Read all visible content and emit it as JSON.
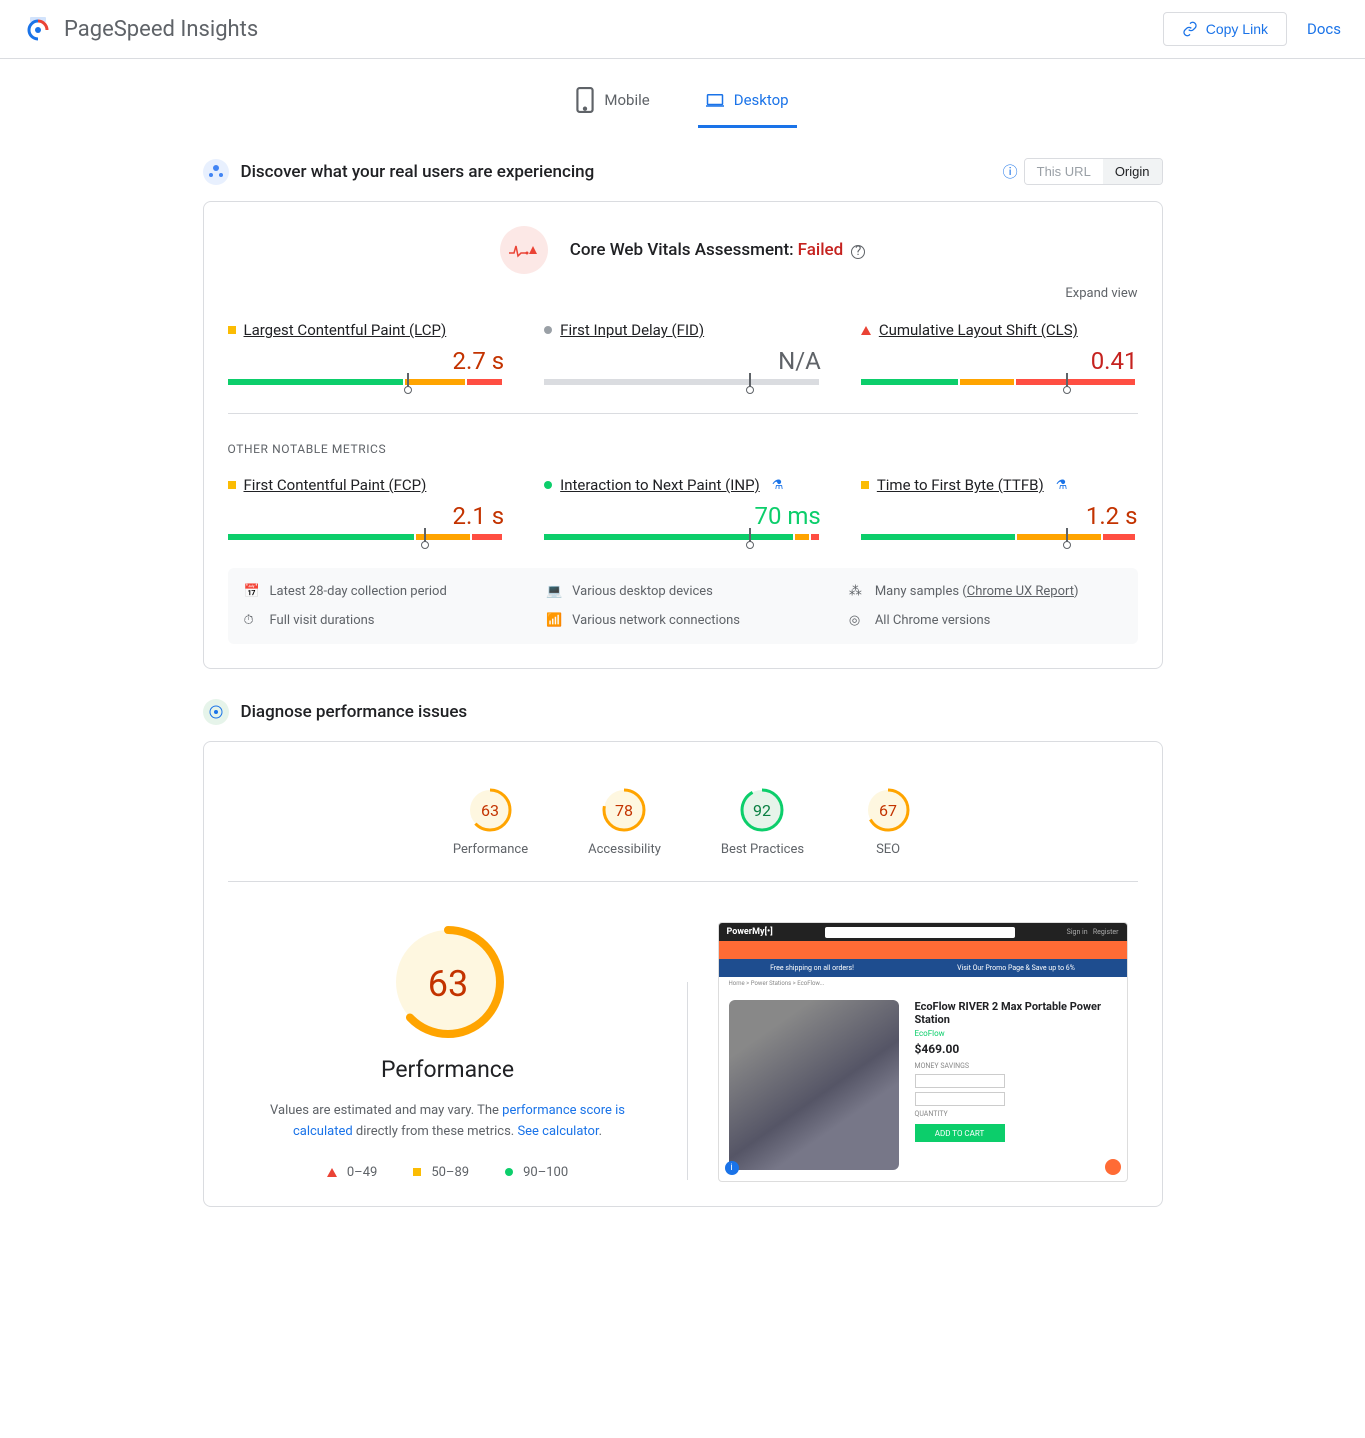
{
  "header": {
    "app_title": "PageSpeed Insights",
    "copy_link": "Copy Link",
    "docs": "Docs"
  },
  "tabs": {
    "mobile": "Mobile",
    "desktop": "Desktop"
  },
  "field": {
    "section_title": "Discover what your real users are experiencing",
    "toggle_url": "This URL",
    "toggle_origin": "Origin",
    "cwv_label": "Core Web Vitals Assessment:",
    "cwv_status": "Failed",
    "expand": "Expand view",
    "other_title": "OTHER NOTABLE METRICS",
    "metrics": {
      "lcp": {
        "name": "Largest Contentful Paint (LCP)",
        "value": "2.7 s"
      },
      "fid": {
        "name": "First Input Delay (FID)",
        "value": "N/A"
      },
      "cls": {
        "name": "Cumulative Layout Shift (CLS)",
        "value": "0.41"
      },
      "fcp": {
        "name": "First Contentful Paint (FCP)",
        "value": "2.1 s"
      },
      "inp": {
        "name": "Interaction to Next Paint (INP)",
        "value": "70 ms"
      },
      "ttfb": {
        "name": "Time to First Byte (TTFB)",
        "value": "1.2 s"
      }
    },
    "info": {
      "period": "Latest 28-day collection period",
      "devices": "Various desktop devices",
      "samples_pre": "Many samples (",
      "samples_link": "Chrome UX Report",
      "samples_post": ")",
      "durations": "Full visit durations",
      "network": "Various network connections",
      "chrome": "All Chrome versions"
    }
  },
  "lab": {
    "section_title": "Diagnose performance issues",
    "scores": {
      "performance": {
        "value": "63",
        "label": "Performance"
      },
      "accessibility": {
        "value": "78",
        "label": "Accessibility"
      },
      "best_practices": {
        "value": "92",
        "label": "Best Practices"
      },
      "seo": {
        "value": "67",
        "label": "SEO"
      }
    },
    "perf_big": "63",
    "perf_title": "Performance",
    "perf_desc_1": "Values are estimated and may vary. The ",
    "perf_link_1": "performance score is calculated",
    "perf_desc_2": " directly from these metrics. ",
    "perf_link_2": "See calculator",
    "perf_desc_3": ".",
    "legend": {
      "poor": "0–49",
      "avg": "50–89",
      "good": "90–100"
    },
    "screenshot": {
      "logo": "PowerMy[•]",
      "banner_1": "Free shipping on all orders!",
      "banner_2": "Visit Our Promo Page & Save up to 6%",
      "product": "EcoFlow RIVER 2 Max Portable Power Station",
      "brand": "EcoFlow",
      "price": "$469.00",
      "addcart": "ADD TO CART"
    }
  }
}
